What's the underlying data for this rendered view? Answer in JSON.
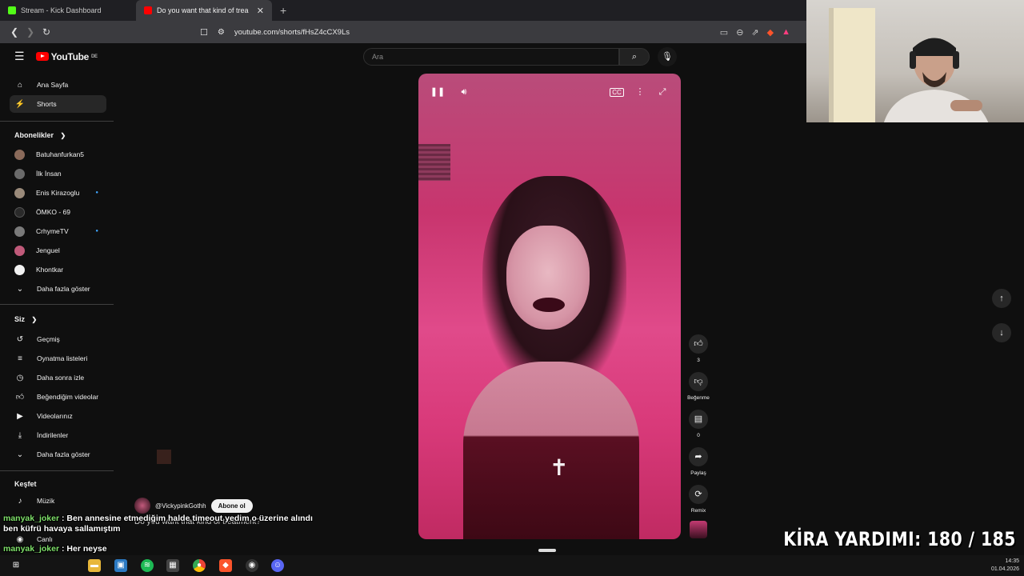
{
  "browser": {
    "tabs": [
      {
        "title": "Stream - Kick Dashboard",
        "favicon_color": "#53fc18"
      },
      {
        "title": "Do you want that kind of trea",
        "favicon_color": "#ff0000"
      }
    ],
    "new_tab": "+",
    "url": "youtube.com/shorts/fHsZ4cCX9Ls"
  },
  "youtube": {
    "logo": "YouTube",
    "country": "DE",
    "search_placeholder": "Ara",
    "nav": [
      {
        "label": "Ana Sayfa",
        "icon": "home-icon"
      },
      {
        "label": "Shorts",
        "icon": "shorts-icon"
      }
    ],
    "subs_heading": "Abonelikler",
    "subscriptions": [
      {
        "label": "Batuhanfurkan5",
        "color": "#8a6a5a",
        "dot": false
      },
      {
        "label": "İlk İnsan",
        "color": "#6a6a6a",
        "dot": false
      },
      {
        "label": "Enis Kirazoglu",
        "color": "#9a8a7a",
        "dot": true
      },
      {
        "label": "ÖMKO - 69",
        "color": "#2a2a2a",
        "dot": false
      },
      {
        "label": "CrhymeTV",
        "color": "#7a7a7a",
        "dot": true
      },
      {
        "label": "Jenguel",
        "color": "#c05a7a",
        "dot": false
      },
      {
        "label": "Khontkar",
        "color": "#f1f1f1",
        "dot": false
      }
    ],
    "subs_more": "Daha fazla göster",
    "you_heading": "Siz",
    "you_items": [
      {
        "label": "Geçmiş",
        "icon": "history-icon"
      },
      {
        "label": "Oynatma listeleri",
        "icon": "playlist-icon"
      },
      {
        "label": "Daha sonra izle",
        "icon": "clock-icon"
      },
      {
        "label": "Beğendiğim videolar",
        "icon": "like-icon"
      },
      {
        "label": "Videolarınız",
        "icon": "video-icon"
      },
      {
        "label": "İndirilenler",
        "icon": "download-icon"
      }
    ],
    "you_more": "Daha fazla göster",
    "explore_heading": "Keşfet",
    "explore_items": [
      {
        "label": "Müzik"
      },
      {
        "label": "Canlı"
      }
    ],
    "actions": {
      "likes": "3",
      "dislike_label": "Beğenme",
      "comments": "0",
      "share_label": "Paylaş",
      "remix_label": "Remix"
    },
    "channel": "@VickypinkGothh",
    "subscribe_label": "Abone ol",
    "video_title": "Do you want that kind of treatment?"
  },
  "chat": [
    {
      "user": "manyak_joker",
      "message": "Ben annesine etmediğim halde timeout yedim o üzerine alındı ben küfrü havaya sallamıştım"
    },
    {
      "user": "manyak_joker",
      "message": "Her neyse"
    },
    {
      "user": "manyak_joker",
      "message": ""
    }
  ],
  "overlay": {
    "label": "KİRA YARDIMI:",
    "current": 180,
    "goal": 185,
    "progress": "180 / 185"
  },
  "taskbar": {
    "time": "14:35",
    "date": "01.04.2026"
  }
}
